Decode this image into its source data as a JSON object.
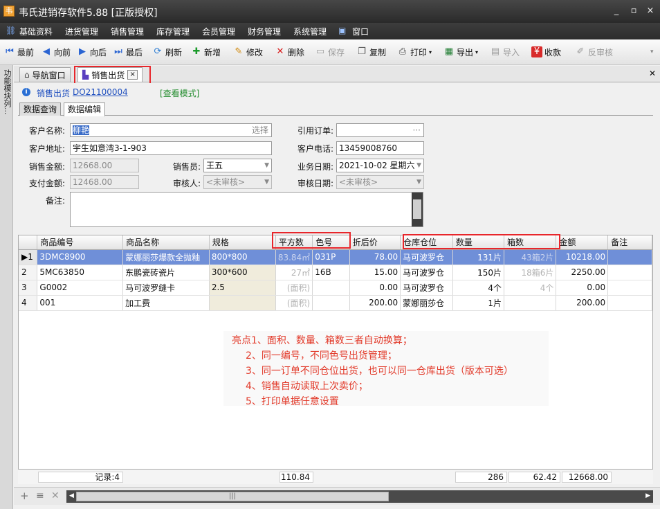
{
  "window": {
    "title": "韦氏进销存软件5.88 [正版授权]",
    "app_icon_text": "韦",
    "min_label": "_",
    "max_label": "▫",
    "close_label": "×"
  },
  "menu": {
    "items": [
      "基础资料",
      "进货管理",
      "销售管理",
      "库存管理",
      "会员管理",
      "财务管理",
      "系统管理",
      "窗口"
    ]
  },
  "toolbar": {
    "first": "最前",
    "prev": "向前",
    "next": "向后",
    "last": "最后",
    "refresh": "刷新",
    "add": "新增",
    "edit": "修改",
    "delete": "删除",
    "save": "保存",
    "copy": "复制",
    "print": "打印",
    "export": "导出",
    "import": "导入",
    "collect": "收款",
    "unaudit": "反审核"
  },
  "sidebar": {
    "label": "功能模块列..."
  },
  "doc_tabs": {
    "nav": "导航窗口",
    "sales": "销售出货",
    "close": "×"
  },
  "info": {
    "module": "销售出货",
    "doc_no": "DO21100004",
    "mode": "[查看模式]"
  },
  "inner_tabs": {
    "query": "数据查询",
    "edit": "数据编辑"
  },
  "form": {
    "customer_name_label": "客户名称:",
    "customer_name": "柳艳",
    "select_label": "选择",
    "ref_order_label": "引用订单:",
    "ref_order_btn": "···",
    "customer_addr_label": "客户地址:",
    "customer_addr": "宇生如意湾3-1-903",
    "customer_phone_label": "客户电话:",
    "customer_phone": "13459008760",
    "sales_amount_label": "销售金额:",
    "sales_amount": "12668.00",
    "salesman_label": "销售员:",
    "salesman": "王五",
    "biz_date_label": "业务日期:",
    "biz_date": "2021-10-02 星期六",
    "paid_amount_label": "支付金额:",
    "paid_amount": "12468.00",
    "auditor_label": "审核人:",
    "auditor": "<未审核>",
    "audit_date_label": "审核日期:",
    "audit_date": "<未审核>",
    "remark_label": "备注:"
  },
  "grid": {
    "columns": [
      "商品编号",
      "商品名称",
      "规格",
      "平方数",
      "色号",
      "折后价",
      "仓库仓位",
      "数量",
      "箱数",
      "金额",
      "备注"
    ],
    "rows": [
      {
        "rownum": "1",
        "code": "3DMC8900",
        "name": "蒙娜丽莎爆款全抛釉",
        "spec": "800*800",
        "sqm": "83.84㎡",
        "color": "031P",
        "price": "78.00",
        "warehouse": "马可波罗仓",
        "qty": "131片",
        "boxes": "43箱2片",
        "amount": "10218.00",
        "note": ""
      },
      {
        "rownum": "2",
        "code": "5MC63850",
        "name": "东鹏瓷砖瓷片",
        "spec": "300*600",
        "sqm": "27㎡",
        "color": "16B",
        "price": "15.00",
        "warehouse": "马可波罗仓",
        "qty": "150片",
        "boxes": "18箱6片",
        "amount": "2250.00",
        "note": ""
      },
      {
        "rownum": "3",
        "code": "G0002",
        "name": "马可波罗缝卡",
        "spec": "2.5",
        "sqm": "(面积)",
        "color": "",
        "price": "0.00",
        "warehouse": "马可波罗仓",
        "qty": "4个",
        "boxes": "4个",
        "amount": "0.00",
        "note": ""
      },
      {
        "rownum": "4",
        "code": "001",
        "name": "加工费",
        "spec": "",
        "sqm": "(面积)",
        "color": "",
        "price": "200.00",
        "warehouse": "蒙娜丽莎仓",
        "qty": "1片",
        "boxes": "",
        "amount": "200.00",
        "note": ""
      }
    ],
    "footer": {
      "records": "记录:4",
      "sqm_total": "110.84",
      "qty_total": "286",
      "boxes_total": "62.42",
      "amount_total": "12668.00"
    }
  },
  "annotation": {
    "lines": [
      "亮点1、面积、数量、箱数三者自动换算；",
      "2、同一编号，不同色号出货管理；",
      "3、同一订单不同仓位出货，也可以同一仓库出货（版本可选）",
      "4、销售自动读取上次卖价；",
      "5、打印单据任意设置"
    ]
  },
  "navbar": {
    "add": "+",
    "edit": "≡",
    "delete": "✕"
  },
  "colors": {
    "selected_row": "#6f8fd8",
    "highlight_box": "#e8262b",
    "annotation_text": "#e23a2a",
    "link": "#1f4fbf"
  }
}
